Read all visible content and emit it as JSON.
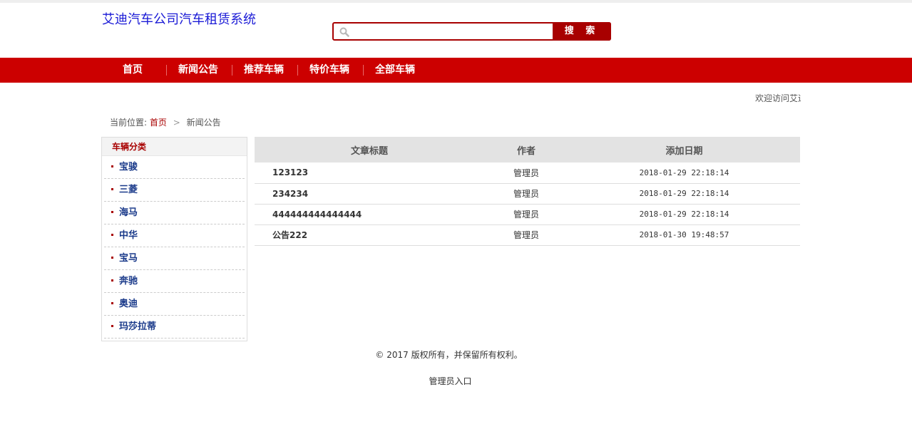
{
  "header": {
    "site_title": "艾迪汽车公司汽车租赁系统",
    "search": {
      "placeholder": "",
      "value": "",
      "button_label": "搜 索"
    }
  },
  "nav": {
    "items": [
      {
        "label": "首页"
      },
      {
        "label": "新闻公告"
      },
      {
        "label": "推荐车辆"
      },
      {
        "label": "特价车辆"
      },
      {
        "label": "全部车辆"
      }
    ]
  },
  "welcome_text": "欢迎访问艾迪汽车公司汽车租赁系统",
  "breadcrumb": {
    "prefix": "当前位置:",
    "home": "首页",
    "separator": ">",
    "current": "新闻公告"
  },
  "sidebar": {
    "heading": "车辆分类",
    "items": [
      {
        "label": "宝骏"
      },
      {
        "label": "三菱"
      },
      {
        "label": "海马"
      },
      {
        "label": "中华"
      },
      {
        "label": "宝马"
      },
      {
        "label": "奔驰"
      },
      {
        "label": "奥迪"
      },
      {
        "label": "玛莎拉蒂"
      }
    ]
  },
  "news_table": {
    "headers": {
      "title": "文章标题",
      "author": "作者",
      "date": "添加日期"
    },
    "rows": [
      {
        "title": "123123",
        "author": "管理员",
        "date": "2018-01-29 22:18:14"
      },
      {
        "title": "234234",
        "author": "管理员",
        "date": "2018-01-29 22:18:14"
      },
      {
        "title": "444444444444444",
        "author": "管理员",
        "date": "2018-01-29 22:18:14"
      },
      {
        "title": "公告222",
        "author": "管理员",
        "date": "2018-01-30 19:48:57"
      }
    ]
  },
  "footer": {
    "copyright": "© 2017 版权所有，并保留所有权利。",
    "admin_link": "管理员入口"
  },
  "colors": {
    "brand_red": "#cc0000",
    "dark_red": "#a80000",
    "title_blue": "#1a1ad6",
    "sidebar_link_blue": "#1a3a8a"
  }
}
